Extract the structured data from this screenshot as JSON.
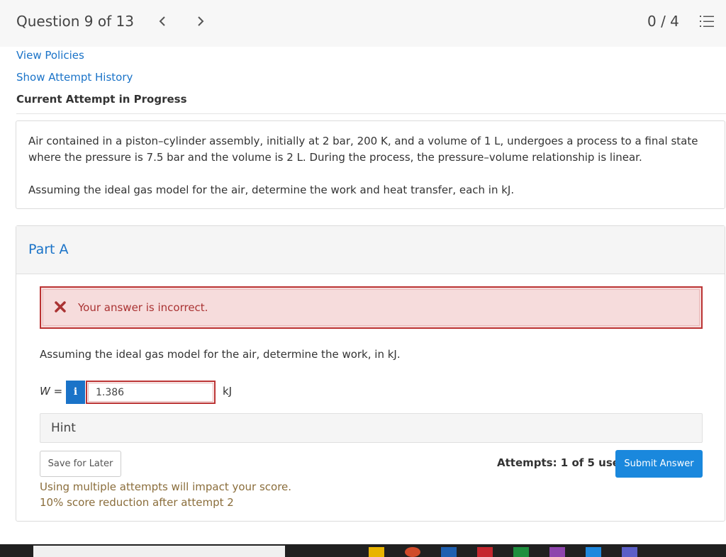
{
  "header": {
    "question_title": "Question 9 of 13",
    "score": "0 / 4"
  },
  "links": {
    "view_policies": "View Policies",
    "show_attempt_history": "Show Attempt History"
  },
  "status": {
    "current_attempt": "Current Attempt in Progress"
  },
  "problem": {
    "paragraph1": "Air contained in a piston–cylinder assembly, initially at 2 bar, 200 K, and a volume of 1 L, undergoes a process to a final state where the pressure is 7.5 bar and the volume is 2 L. During the process, the pressure–volume relationship is linear.",
    "paragraph2": "Assuming the ideal gas model for the air, determine the work and heat transfer, each in kJ."
  },
  "part": {
    "title": "Part A",
    "feedback": "Your answer is incorrect.",
    "question": "Assuming the ideal gas model for the air, determine the work, in kJ.",
    "variable_label": "W =",
    "info_label": "i",
    "answer_value": "1.386",
    "unit": "kJ",
    "hint_label": "Hint",
    "save_label": "Save for Later",
    "attempts_text": "Attempts: 1 of 5 used",
    "submit_label": "Submit Answer",
    "warning1": "Using multiple attempts will impact your score.",
    "warning2": "10% score reduction after attempt 2"
  },
  "icons": {
    "prev": "chevron-left-icon",
    "next": "chevron-right-icon",
    "list": "numbered-list-icon",
    "incorrect": "x-mark-icon"
  },
  "colors": {
    "link": "#1a73c8",
    "error_border": "#b33333",
    "error_bg": "#f6dcdc",
    "submit_bg": "#1a88dd",
    "warning_text": "#8a6d3b"
  }
}
